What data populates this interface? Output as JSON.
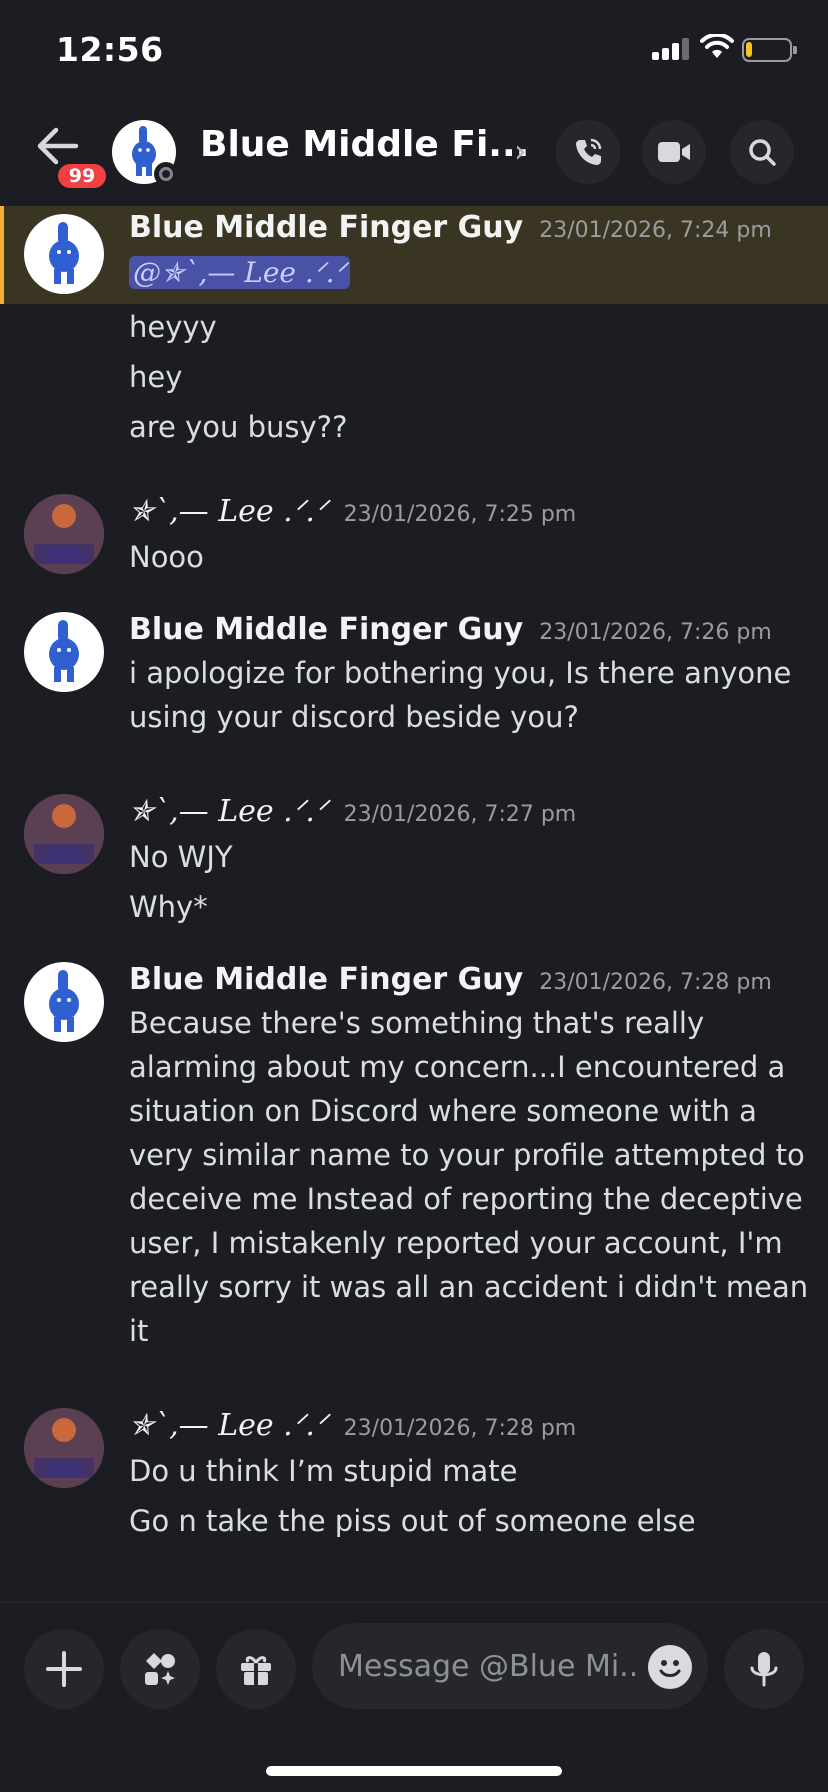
{
  "status_bar": {
    "time": "12:56"
  },
  "header": {
    "back_badge": "99",
    "title": "Blue Middle Fi...",
    "chevron": "›",
    "icons": [
      "phone-icon",
      "video-camera-icon",
      "search-icon"
    ]
  },
  "messages": [
    {
      "author": "Blue Middle Finger Guy",
      "timestamp": "23/01/2026, 7:24 pm",
      "mention": "@✯`,— Lee .ᐟ.ᐟ",
      "lines": [
        "heyyy",
        "hey",
        "are you busy??"
      ]
    },
    {
      "author": "✯`,— Lee .ᐟ.ᐟ",
      "timestamp": "23/01/2026, 7:25 pm",
      "lines": [
        "Nooo"
      ]
    },
    {
      "author": "Blue Middle Finger Guy",
      "timestamp": "23/01/2026, 7:26 pm",
      "lines": [
        "i apologize for bothering you, Is there anyone",
        "using your discord beside you?"
      ]
    },
    {
      "author": "✯`,— Lee .ᐟ.ᐟ",
      "timestamp": "23/01/2026, 7:27 pm",
      "lines": [
        "No WJY",
        "Why*"
      ]
    },
    {
      "author": "Blue Middle Finger Guy",
      "timestamp": "23/01/2026, 7:28 pm",
      "lines": [
        "Because there's something that's really",
        "alarming about my concern...I encountered a",
        "situation on Discord where someone with a",
        "very similar name to your profile attempted to",
        "deceive me Instead of reporting the deceptive",
        "user, I mistakenly reported your account, I'm",
        "really sorry it was all an accident i didn't mean",
        "it"
      ]
    },
    {
      "author": "✯`,— Lee .ᐟ.ᐟ",
      "timestamp": "23/01/2026, 7:28 pm",
      "lines": [
        "Do u think I’m stupid mate",
        "Go n take the piss out of someone else"
      ]
    }
  ],
  "input": {
    "placeholder": "Message @Blue Mi..."
  },
  "colors": {
    "accent": "#5865f2",
    "mention_bg": "#4a52a8",
    "highlight": "#f0b132",
    "badge": "#f23f43"
  }
}
